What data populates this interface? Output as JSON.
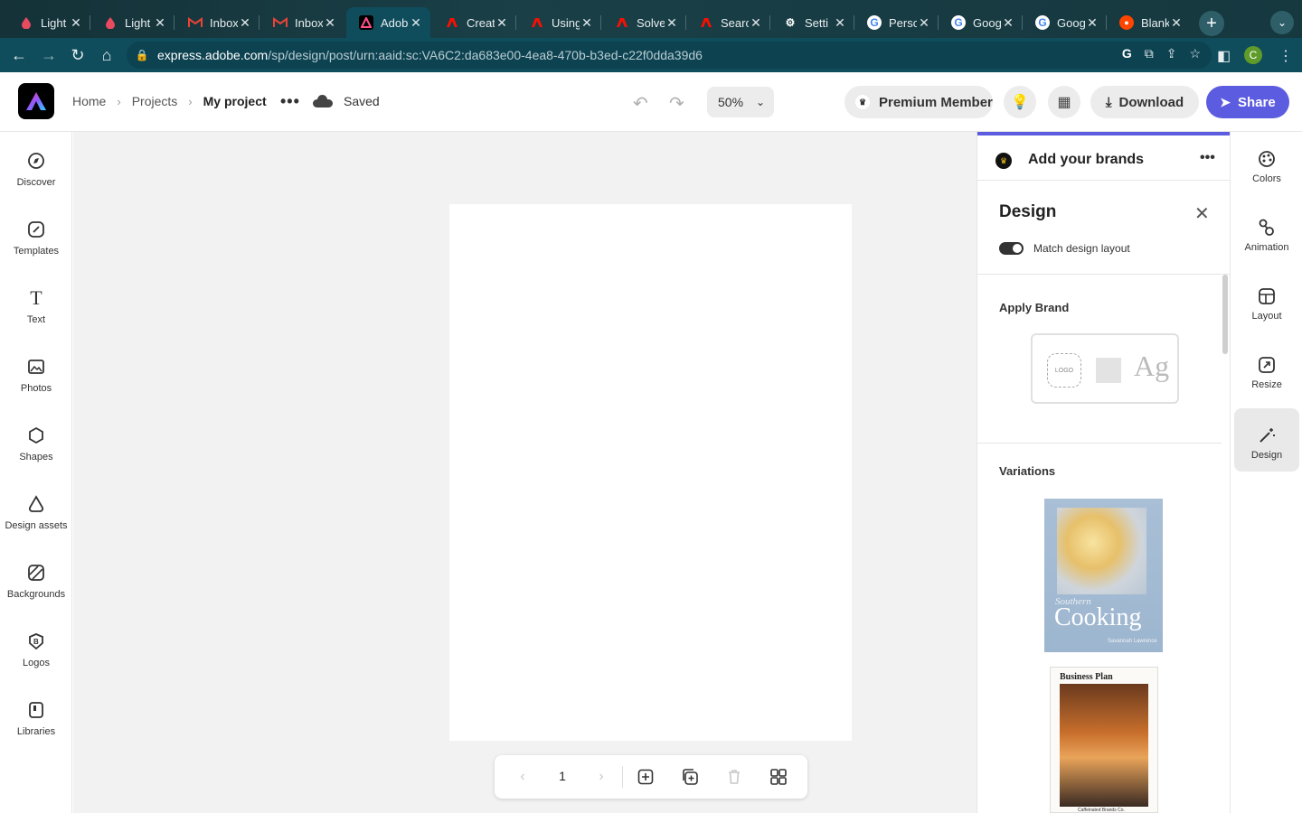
{
  "browser": {
    "tabs": [
      {
        "title": "Light",
        "icon": "droplet-icon",
        "color": "#e84a5f"
      },
      {
        "title": "Light",
        "icon": "droplet-icon",
        "color": "#e84a5f"
      },
      {
        "title": "Inbox",
        "icon": "gmail-icon",
        "color": "#ea4335"
      },
      {
        "title": "Inbox",
        "icon": "gmail-icon",
        "color": "#ea4335"
      },
      {
        "title": "Adob",
        "icon": "adobe-express-icon",
        "color": "#ffffff"
      },
      {
        "title": "Creat",
        "icon": "adobe-icon",
        "color": "#fa0f00"
      },
      {
        "title": "Using",
        "icon": "adobe-icon",
        "color": "#fa0f00"
      },
      {
        "title": "Solve",
        "icon": "adobe-icon",
        "color": "#fa0f00"
      },
      {
        "title": "Searc",
        "icon": "adobe-icon",
        "color": "#fa0f00"
      },
      {
        "title": "Setti",
        "icon": "gear-icon",
        "color": "#ffffff"
      },
      {
        "title": "Perso",
        "icon": "google-icon",
        "color": "#ffffff"
      },
      {
        "title": "Goog",
        "icon": "google-icon",
        "color": "#ffffff"
      },
      {
        "title": "Goog",
        "icon": "google-icon",
        "color": "#ffffff"
      },
      {
        "title": "Blank",
        "icon": "reddit-icon",
        "color": "#ff4500"
      }
    ],
    "active_tab_index": 4,
    "url_host": "express.adobe.com",
    "url_path": "/sp/design/post/urn:aaid:sc:VA6C2:da683e00-4ea8-470b-b3ed-c22f0dda39d6",
    "profile_initial": "C"
  },
  "header": {
    "breadcrumbs": [
      "Home",
      "Projects",
      "My project"
    ],
    "status": "Saved",
    "zoom": "50%",
    "premium_label": "Premium Member",
    "download_label": "Download",
    "share_label": "Share",
    "accent_color": "#5c5ce0"
  },
  "left_rail": [
    {
      "label": "Discover",
      "icon": "compass-icon"
    },
    {
      "label": "Templates",
      "icon": "templates-icon"
    },
    {
      "label": "Text",
      "icon": "text-icon"
    },
    {
      "label": "Photos",
      "icon": "photo-icon"
    },
    {
      "label": "Shapes",
      "icon": "shapes-icon"
    },
    {
      "label": "Design assets",
      "icon": "design-assets-icon"
    },
    {
      "label": "Backgrounds",
      "icon": "backgrounds-icon"
    },
    {
      "label": "Logos",
      "icon": "logo-badge-icon"
    },
    {
      "label": "Libraries",
      "icon": "libraries-icon"
    }
  ],
  "canvas": {
    "page_number": "1"
  },
  "design_panel": {
    "brand_bar_title": "Add your brands",
    "title": "Design",
    "toggle_label": "Match design layout",
    "toggle_on": true,
    "apply_brand_label": "Apply Brand",
    "logo_placeholder": "LOGO",
    "type_sample": "Ag",
    "variations_label": "Variations",
    "variation_1": {
      "line1": "Southern",
      "line2": "Cooking",
      "line3": "Savannah Lawrence"
    },
    "variation_2": {
      "title": "Business Plan",
      "footer": "Caffeinated Brands Co."
    }
  },
  "right_rail": [
    {
      "label": "Colors",
      "icon": "palette-icon",
      "active": false
    },
    {
      "label": "Animation",
      "icon": "animation-icon",
      "active": false
    },
    {
      "label": "Layout",
      "icon": "layout-icon",
      "active": false
    },
    {
      "label": "Resize",
      "icon": "resize-icon",
      "active": false
    },
    {
      "label": "Design",
      "icon": "magic-wand-icon",
      "active": true
    }
  ]
}
